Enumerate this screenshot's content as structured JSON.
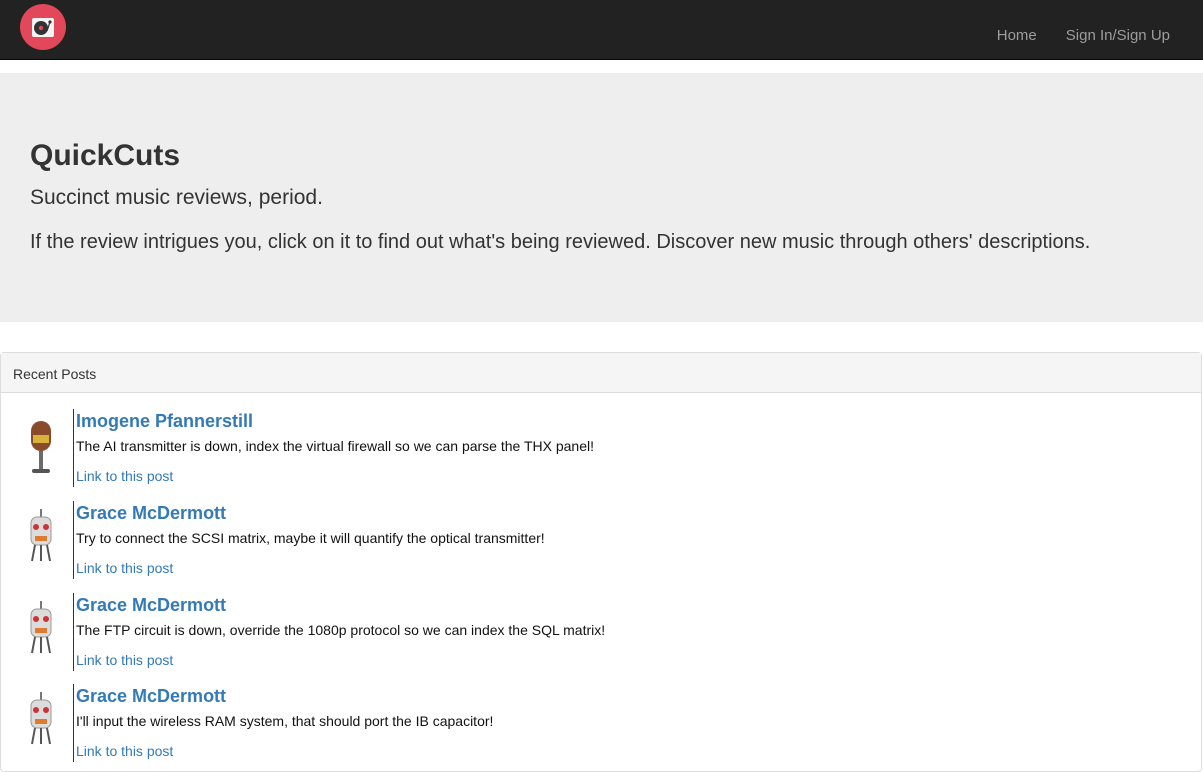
{
  "navbar": {
    "logo_icon": "turntable-icon",
    "logo_color": "#e2485a",
    "links": [
      {
        "label": "Home"
      },
      {
        "label": "Sign In/Sign Up"
      }
    ]
  },
  "jumbotron": {
    "title": "QuickCuts",
    "subtitle": "Succinct music reviews, period.",
    "description": "If the review intrigues you, click on it to find out what's being reviewed. Discover new music through others' descriptions."
  },
  "recent_posts": {
    "heading": "Recent Posts",
    "posts": [
      {
        "author": "Imogene Pfannerstill",
        "avatar_icon": "microphone-avatar-icon",
        "text": "The AI transmitter is down, index the virtual firewall so we can parse the THX panel!",
        "link": "Link to this post"
      },
      {
        "author": "Grace McDermott",
        "avatar_icon": "robot-avatar-icon",
        "text": "Try to connect the SCSI matrix, maybe it will quantify the optical transmitter!",
        "link": "Link to this post"
      },
      {
        "author": "Grace McDermott",
        "avatar_icon": "robot-avatar-icon",
        "text": "The FTP circuit is down, override the 1080p protocol so we can index the SQL matrix!",
        "link": "Link to this post"
      },
      {
        "author": "Grace McDermott",
        "avatar_icon": "robot-avatar-icon",
        "text": "I'll input the wireless RAM system, that should port the IB capacitor!",
        "link": "Link to this post"
      }
    ]
  },
  "colors": {
    "navbar_bg": "#222222",
    "jumbotron_bg": "#eeeeee",
    "link": "#337ab7"
  }
}
